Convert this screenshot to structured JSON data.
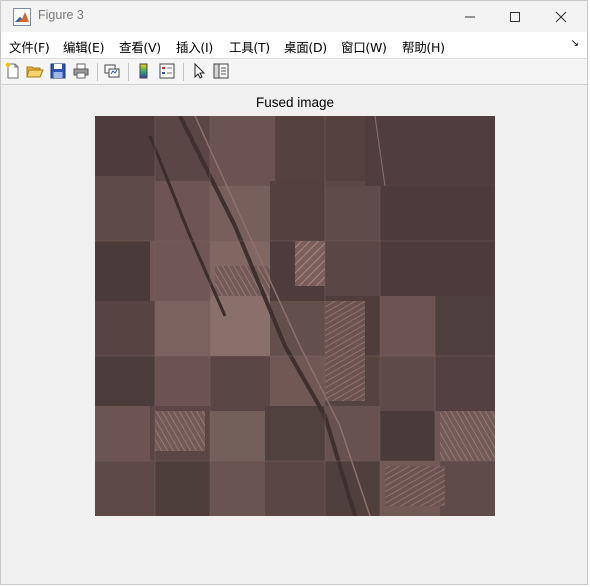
{
  "window": {
    "title": "Figure 3"
  },
  "menu": {
    "items": [
      {
        "label": "文件(F)"
      },
      {
        "label": "编辑(E)"
      },
      {
        "label": "查看(V)"
      },
      {
        "label": "插入(I)"
      },
      {
        "label": "工具(T)"
      },
      {
        "label": "桌面(D)"
      },
      {
        "label": "窗口(W)"
      },
      {
        "label": "帮助(H)"
      }
    ]
  },
  "toolbar": {
    "icons": [
      "new-figure-icon",
      "open-file-icon",
      "save-icon",
      "print-icon",
      "link-plot-icon",
      "colorbar-icon",
      "legend-icon",
      "edit-plot-icon",
      "property-inspector-icon"
    ]
  },
  "figure": {
    "title": "Fused image",
    "image_tone": "#5e4a48"
  }
}
